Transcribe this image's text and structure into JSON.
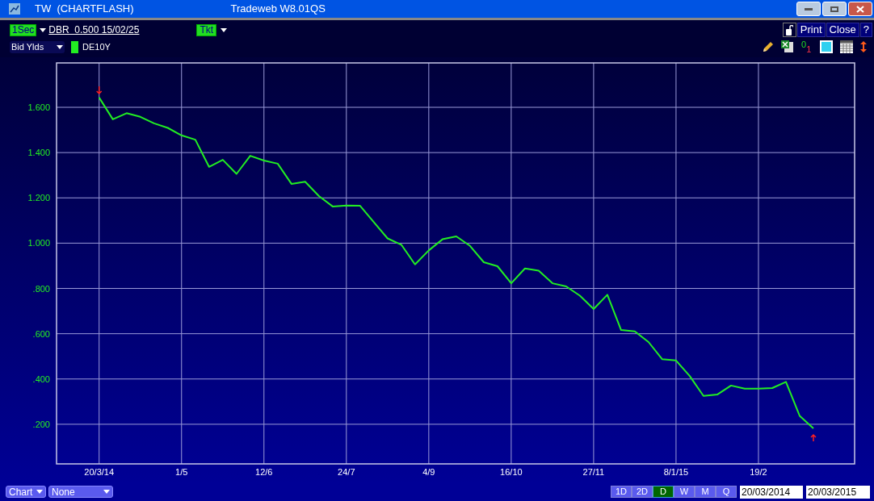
{
  "window": {
    "title": "TW  (CHARTFLASH)",
    "app": "Tradeweb W8.01QS"
  },
  "toolbar": {
    "interval": "1Sec",
    "instrument": "DBR  0.500 15/02/25",
    "ticket": "Tkt",
    "buttons": [
      "Print",
      "Close",
      "?"
    ],
    "fraction_tool": {
      "numerator": "0",
      "denominator": "1"
    }
  },
  "series_selector": {
    "value": "Bid Ylds"
  },
  "chart": {
    "chart_data": {
      "type": "line",
      "categories": [
        "20/3/14",
        null,
        null,
        null,
        null,
        null,
        "1/5",
        null,
        null,
        null,
        null,
        null,
        "12/6",
        null,
        null,
        null,
        null,
        null,
        "24/7",
        null,
        null,
        null,
        null,
        null,
        "4/9",
        null,
        null,
        null,
        null,
        null,
        "16/10",
        null,
        null,
        null,
        null,
        null,
        "27/11",
        null,
        null,
        null,
        null,
        null,
        "8/1/15",
        null,
        null,
        null,
        null,
        null,
        "19/2",
        null,
        null,
        null,
        null
      ],
      "series": [
        {
          "name": "DE10Y",
          "color": "#22ee22",
          "values": [
            1.643,
            1.547,
            1.574,
            1.558,
            1.529,
            1.509,
            1.476,
            1.457,
            1.337,
            1.368,
            1.306,
            1.386,
            1.365,
            1.351,
            1.262,
            1.271,
            1.208,
            1.162,
            1.166,
            1.165,
            1.093,
            1.021,
            0.993,
            0.906,
            0.968,
            1.017,
            1.03,
            0.988,
            0.916,
            0.898,
            0.823,
            0.888,
            0.878,
            0.823,
            0.809,
            0.768,
            0.709,
            0.772,
            0.616,
            0.61,
            0.563,
            0.487,
            0.482,
            0.413,
            0.325,
            0.331,
            0.371,
            0.357,
            0.357,
            0.36,
            0.387,
            0.237,
            0.182
          ]
        }
      ],
      "grid": true,
      "ylim": [
        0.025,
        1.796
      ],
      "yticks": [
        {
          "value": 0.2,
          "label": ".200"
        },
        {
          "value": 0.4,
          "label": ".400"
        },
        {
          "value": 0.6,
          "label": ".600"
        },
        {
          "value": 0.8,
          "label": ".800"
        },
        {
          "value": 1.0,
          "label": "1.000"
        },
        {
          "value": 1.2,
          "label": "1.200"
        },
        {
          "value": 1.4,
          "label": "1.400"
        },
        {
          "value": 1.6,
          "label": "1.600"
        }
      ]
    }
  },
  "bottom": {
    "chart_type": "Chart",
    "overlay": "None",
    "periods": [
      {
        "label": "1D",
        "selected": false
      },
      {
        "label": "2D",
        "selected": false
      },
      {
        "label": "D",
        "selected": true
      },
      {
        "label": "W",
        "selected": false
      },
      {
        "label": "M",
        "selected": false
      },
      {
        "label": "Q",
        "selected": false
      }
    ],
    "from_date": "20/03/2014",
    "to_date": "20/03/2015"
  }
}
